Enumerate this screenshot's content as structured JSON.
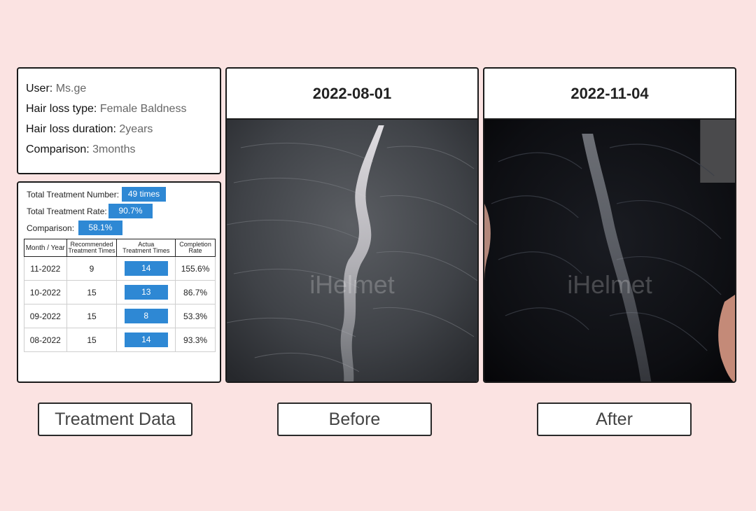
{
  "user_info": {
    "user_label": "User:",
    "user_value": "Ms.ge",
    "type_label": "Hair loss type:",
    "type_value": "Female Baldness",
    "duration_label": "Hair loss duration:",
    "duration_value": "2years",
    "comparison_label": "Comparison:",
    "comparison_value": "3months"
  },
  "treatment_summary": {
    "number_label": "Total Treatment Number:",
    "number_value": "49 times",
    "rate_label": "Total Treatment Rate:",
    "rate_value": "90.7%",
    "comparison_label": "Comparison:",
    "comparison_value": "58.1%"
  },
  "treatment_table": {
    "headers": [
      "Month / Year",
      "Recommended\nTreatment Times",
      "Actua\nTreatment Times",
      "Completion\nRate"
    ],
    "rows": [
      {
        "month": "11-2022",
        "recommended": "9",
        "actual": "14",
        "rate": "155.6%"
      },
      {
        "month": "10-2022",
        "recommended": "15",
        "actual": "13",
        "rate": "86.7%"
      },
      {
        "month": "09-2022",
        "recommended": "15",
        "actual": "8",
        "rate": "53.3%"
      },
      {
        "month": "08-2022",
        "recommended": "15",
        "actual": "14",
        "rate": "93.3%"
      }
    ]
  },
  "before": {
    "date": "2022-08-01",
    "watermark": "iHelmet"
  },
  "after": {
    "date": "2022-11-04",
    "watermark": "iHelmet"
  },
  "captions": {
    "treatment": "Treatment Data",
    "before": "Before",
    "after": "After"
  },
  "colors": {
    "background": "#fbe3e2",
    "accent": "#2e88d4"
  }
}
